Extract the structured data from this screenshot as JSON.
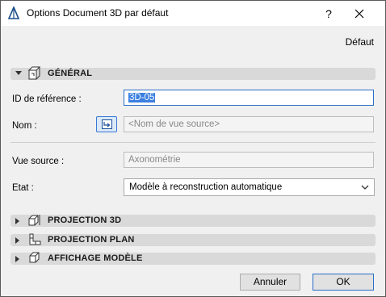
{
  "window": {
    "title": "Options Document 3D par défaut",
    "help_glyph": "?"
  },
  "header": {
    "default_label": "Défaut"
  },
  "sections": {
    "general": {
      "label": "GÉNÉRAL",
      "expanded": true,
      "icon": "document-3d-icon"
    },
    "projection3d": {
      "label": "PROJECTION 3D",
      "expanded": false,
      "icon": "projection-3d-icon"
    },
    "projection_plan": {
      "label": "PROJECTION PLAN",
      "expanded": false,
      "icon": "projection-plan-icon"
    },
    "model_display": {
      "label": "AFFICHAGE MODÈLE",
      "expanded": false,
      "icon": "model-cube-icon"
    }
  },
  "fields": {
    "reference_id": {
      "label": "ID de référence :",
      "value": "3D-05"
    },
    "name": {
      "label": "Nom :",
      "placeholder": "<Nom de vue source>"
    },
    "source_view": {
      "label": "Vue source :",
      "value": "Axonométrie"
    },
    "state": {
      "label": "Etat :",
      "value": "Modèle à reconstruction automatique"
    }
  },
  "buttons": {
    "cancel": "Annuler",
    "ok": "OK"
  },
  "colors": {
    "accent": "#2a6fc9",
    "selection": "#3b7fe0",
    "section_bar": "#d9d9d9"
  }
}
